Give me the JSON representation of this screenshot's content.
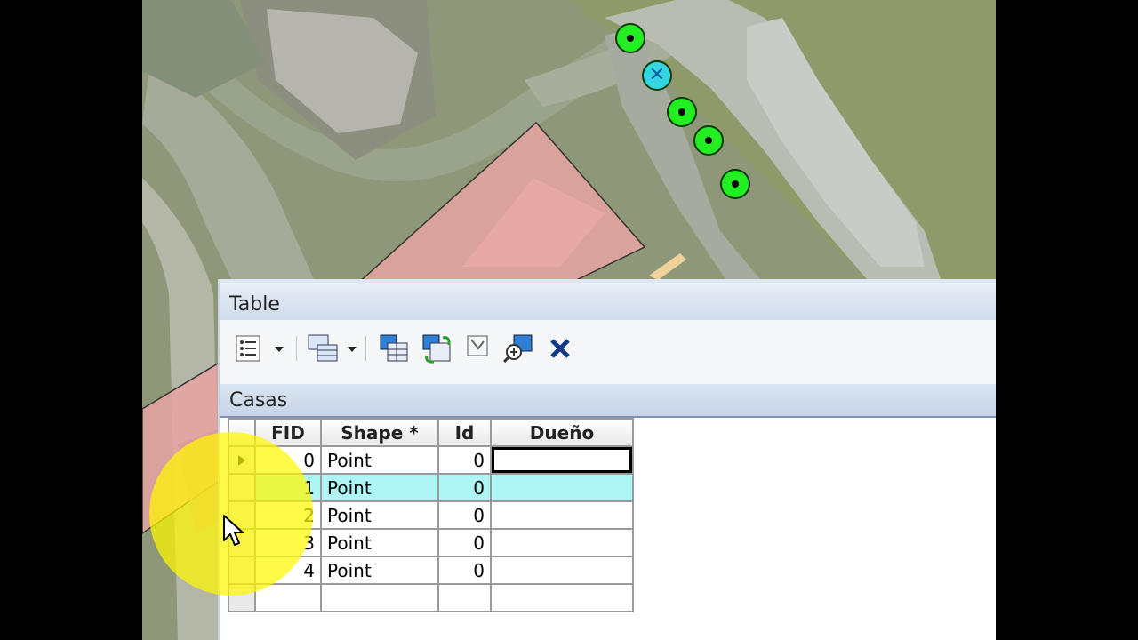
{
  "window": {
    "title": "Table"
  },
  "toolbar": {
    "buttons": [
      {
        "name": "table-options-icon"
      },
      {
        "name": "related-tables-icon"
      },
      {
        "name": "select-by-attributes-icon"
      },
      {
        "name": "switch-selection-icon"
      },
      {
        "name": "clear-selection-icon"
      },
      {
        "name": "zoom-to-selected-icon"
      },
      {
        "name": "delete-selected-icon"
      }
    ]
  },
  "layer_tab": {
    "label": "Casas"
  },
  "attribute_table": {
    "columns": [
      "FID",
      "Shape *",
      "Id",
      "Dueño"
    ],
    "rows": [
      {
        "fid": "0",
        "shape": "Point",
        "id": "0",
        "owner": ""
      },
      {
        "fid": "1",
        "shape": "Point",
        "id": "0",
        "owner": ""
      },
      {
        "fid": "2",
        "shape": "Point",
        "id": "0",
        "owner": ""
      },
      {
        "fid": "3",
        "shape": "Point",
        "id": "0",
        "owner": ""
      },
      {
        "fid": "4",
        "shape": "Point",
        "id": "0",
        "owner": ""
      }
    ],
    "highlighted_row_fid": "1",
    "selection_color": "#aef5f5"
  },
  "map": {
    "points": 5,
    "selected_point": 1,
    "point_color": "#22ee22",
    "selected_point_color": "#33d6e0",
    "polygon_color": "#e8a3a3"
  },
  "cursor_highlight_color": "#fff800"
}
